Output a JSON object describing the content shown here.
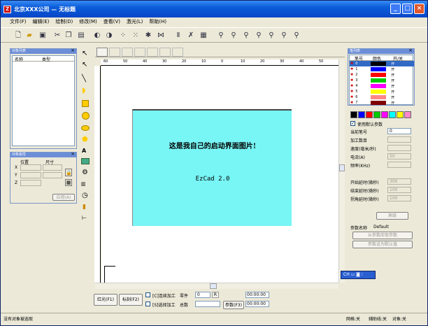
{
  "window": {
    "title": "北京XXX公司 — 无标题"
  },
  "menu": [
    "文件(F)",
    "编辑(E)",
    "绘制(D)",
    "修改(M)",
    "查看(V)",
    "激光(L)",
    "帮助(H)"
  ],
  "object_list": {
    "title": "对象列表",
    "col_name": "名称",
    "col_type": "类型"
  },
  "object_props": {
    "title": "对象属性",
    "col_pos": "位置",
    "col_size": "尺寸",
    "x": "X",
    "y": "Y",
    "z": "Z",
    "apply": "应用(A)"
  },
  "pen_list": {
    "title": "笔列表",
    "col_no": "笔号",
    "col_color": "颜色",
    "col_onoff": "开/关",
    "pens": [
      {
        "no": "0",
        "color": "#000000",
        "state": "开"
      },
      {
        "no": "1",
        "color": "#0000ff",
        "state": "开"
      },
      {
        "no": "2",
        "color": "#ff0000",
        "state": "开"
      },
      {
        "no": "3",
        "color": "#00c000",
        "state": "开"
      },
      {
        "no": "4",
        "color": "#ff00ff",
        "state": "开"
      },
      {
        "no": "5",
        "color": "#ffff00",
        "state": "开"
      },
      {
        "no": "6",
        "color": "#ff8080",
        "state": "开"
      },
      {
        "no": "7",
        "color": "#800000",
        "state": "开"
      }
    ]
  },
  "palette": [
    "#000000",
    "#0000ff",
    "#ff0000",
    "#00c000",
    "#ff00ff",
    "#00ffff",
    "#ffff00",
    "#ff80c0",
    "#800000"
  ],
  "params": {
    "use_default": "使用默认参数",
    "current_pen": "当前笔号",
    "current_pen_value": "0",
    "count": "加工数目",
    "speed": "速度(毫米/秒)",
    "current": "电流(A)",
    "freq": "频率(KHz)",
    "on_delay": "开始延时(微秒)",
    "off_delay": "结束延时(微秒)",
    "corner_delay": "拐角延时(微秒)",
    "advanced": "高级",
    "param_name_label": "参数名称",
    "param_name_value": "Default",
    "from_db": "从参数库取参数",
    "set_default": "参数设为默认值",
    "val_count": "",
    "val_speed": "",
    "val_current": "50",
    "val_freq": "",
    "val_on": "300",
    "val_off": "100",
    "val_corner": "100"
  },
  "splash": {
    "line1": "这是我自己的启动界面图片!",
    "line2": "EzCad 2.0"
  },
  "ruler": [
    "60",
    "50",
    "40",
    "30",
    "20",
    "10",
    "0",
    "10",
    "20",
    "30",
    "40",
    "50"
  ],
  "bottom": {
    "red": "红光(F1)",
    "mark": "标刻(F2)",
    "cont": "[C]连续加工",
    "sel": "[S]选择加工",
    "parts": "零件",
    "total": "总数",
    "parts_value": "0",
    "time1": "00:00:00",
    "time2": "00:00:00",
    "param": "参数(F3)"
  },
  "status": {
    "left": "没有对象被选取",
    "grid": "网格:关",
    "guide": "辅助线:关",
    "snap": "对象:关"
  },
  "ime": "CH"
}
